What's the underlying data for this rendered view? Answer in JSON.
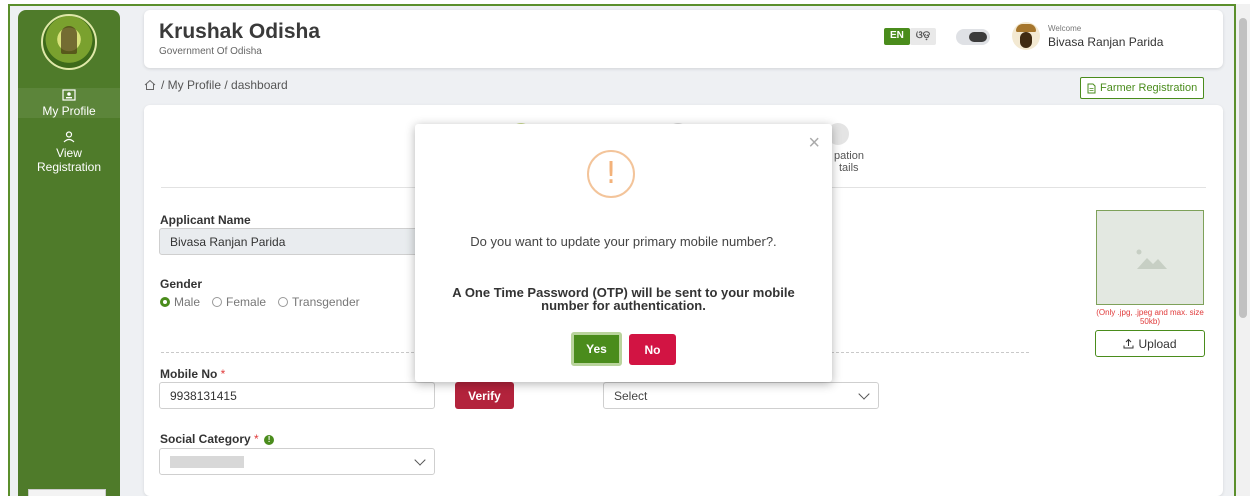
{
  "sidebar": {
    "items": [
      {
        "label": "My Profile",
        "icon": "id-card-icon"
      },
      {
        "label": "View Registration",
        "icon": "person-icon"
      }
    ]
  },
  "header": {
    "title": "Krushak Odisha",
    "subtitle": "Government Of Odisha",
    "lang_en": "EN",
    "lang_or": "ଓଡ଼",
    "welcome": "Welcome",
    "user_name": "Bivasa Ranjan Parida"
  },
  "breadcrumb": {
    "text": "/ My Profile / dashboard"
  },
  "farmer_registration_label": "Farmer Registration",
  "stepper": {
    "visible_label_line1": "pation",
    "visible_label_line2": "tails"
  },
  "form": {
    "applicant_name_label": "Applicant Name",
    "applicant_name_value": "Bivasa Ranjan Parida",
    "gender_label": "Gender",
    "gender_options": [
      "Male",
      "Female",
      "Transgender"
    ],
    "gender_selected": "Male",
    "mobile_label": "Mobile No",
    "mobile_value": "9938131415",
    "verify_label": "Verify",
    "select_placeholder": "Select",
    "social_category_label": "Social Category",
    "required_mark": "*",
    "photo_note": "(Only .jpg, .jpeg and max. size 50kb)",
    "upload_label": "Upload"
  },
  "modal": {
    "icon": "!",
    "question": "Do you want to update your primary mobile number?.",
    "otp_notice": "A One Time Password (OTP) will be sent to your mobile number for authentication.",
    "yes_label": "Yes",
    "no_label": "No",
    "close": "×"
  },
  "colors": {
    "brand_green": "#4f7b2a",
    "accent_green": "#4a8c1c",
    "danger": "#d21443",
    "verify": "#b3233c"
  }
}
